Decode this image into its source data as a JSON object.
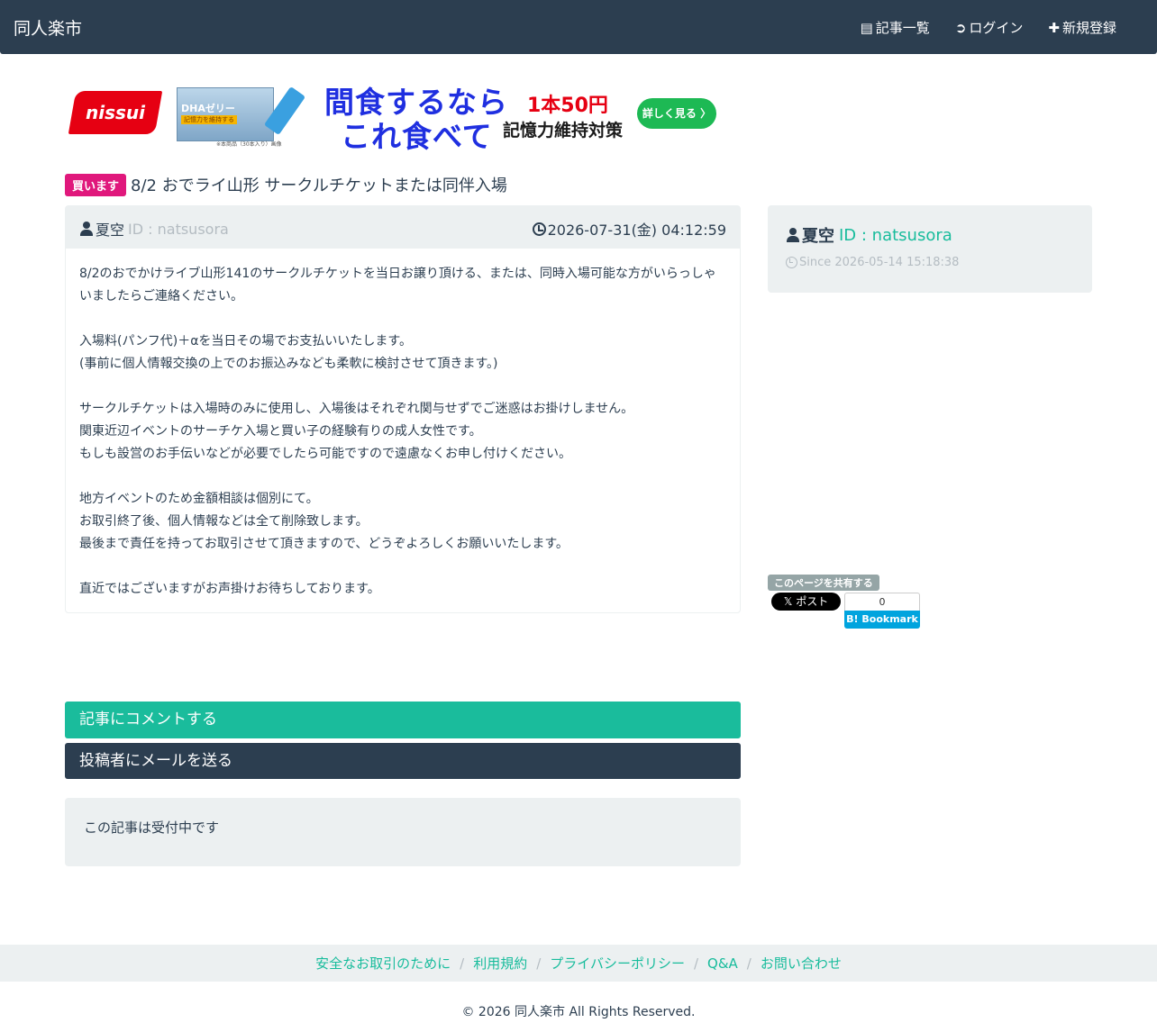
{
  "navbar": {
    "brand": "同人楽市",
    "items": [
      {
        "icon": "list-icon",
        "glyph": "▤",
        "label": "記事一覧"
      },
      {
        "icon": "login-icon",
        "glyph": "➲",
        "label": "ログイン"
      },
      {
        "icon": "plus-icon",
        "glyph": "✚",
        "label": "新規登録"
      }
    ]
  },
  "ad": {
    "brand": "nissui",
    "product_name": "DHAゼリー",
    "product_badge": "記憶力を維持する",
    "caption": "※本商品（30本入り）画像",
    "headline_1": "間食するなら",
    "headline_2": "これ食べて",
    "price": "1本50円",
    "subline": "記憶力維持対策",
    "button": "詳しく見る 〉"
  },
  "post": {
    "badge": "買います",
    "title": "8/2 おでライ山形 サークルチケットまたは同伴入場",
    "author_name": "夏空",
    "author_id": "ID : natsusora",
    "datetime": "2026-07-31(金) 04:12:59",
    "paragraphs": [
      "8/2のおでかけライブ山形141のサークルチケットを当日お譲り頂ける、または、同時入場可能な方がいらっしゃいましたらご連絡ください。",
      "入場料(パンフ代)＋αを当日その場でお支払いいたします。\n(事前に個人情報交換の上でのお振込みなども柔軟に検討させて頂きます。)",
      "サークルチケットは入場時のみに使用し、入場後はそれぞれ関与せずでご迷惑はお掛けしません。\n関東近辺イベントのサーチケ入場と買い子の経験有りの成人女性です。\nもしも設営のお手伝いなどが必要でしたら可能ですので遠慮なくお申し付けください。",
      "地方イベントのため金額相談は個別にて。\nお取引終了後、個人情報などは全て削除致します。\n最後まで責任を持ってお取引させて頂きますので、どうぞよろしくお願いいたします。",
      "直近ではございますがお声掛けお待ちしております。"
    ]
  },
  "actions": {
    "comment": "記事にコメントする",
    "mail": "投稿者にメールを送る",
    "status": "この記事は受付中です"
  },
  "profile": {
    "name": "夏空",
    "id": "ID : natsusora",
    "since": "Since 2026-05-14 15:18:38"
  },
  "share": {
    "label": "このページを共有する",
    "x_button": "𝕏 ポスト",
    "hatena_count": "0",
    "hatena_label": "B! Bookmark"
  },
  "footer": {
    "links": [
      "安全なお取引のために",
      "利用規約",
      "プライバシーポリシー",
      "Q&A",
      "お問い合わせ"
    ],
    "copyright": "© 2026 同人楽市 All Rights Reserved."
  },
  "colors": {
    "navbar": "#2c3e50",
    "accent": "#18bc9c",
    "badge": "#e0187c",
    "light": "#ecf0f1"
  }
}
